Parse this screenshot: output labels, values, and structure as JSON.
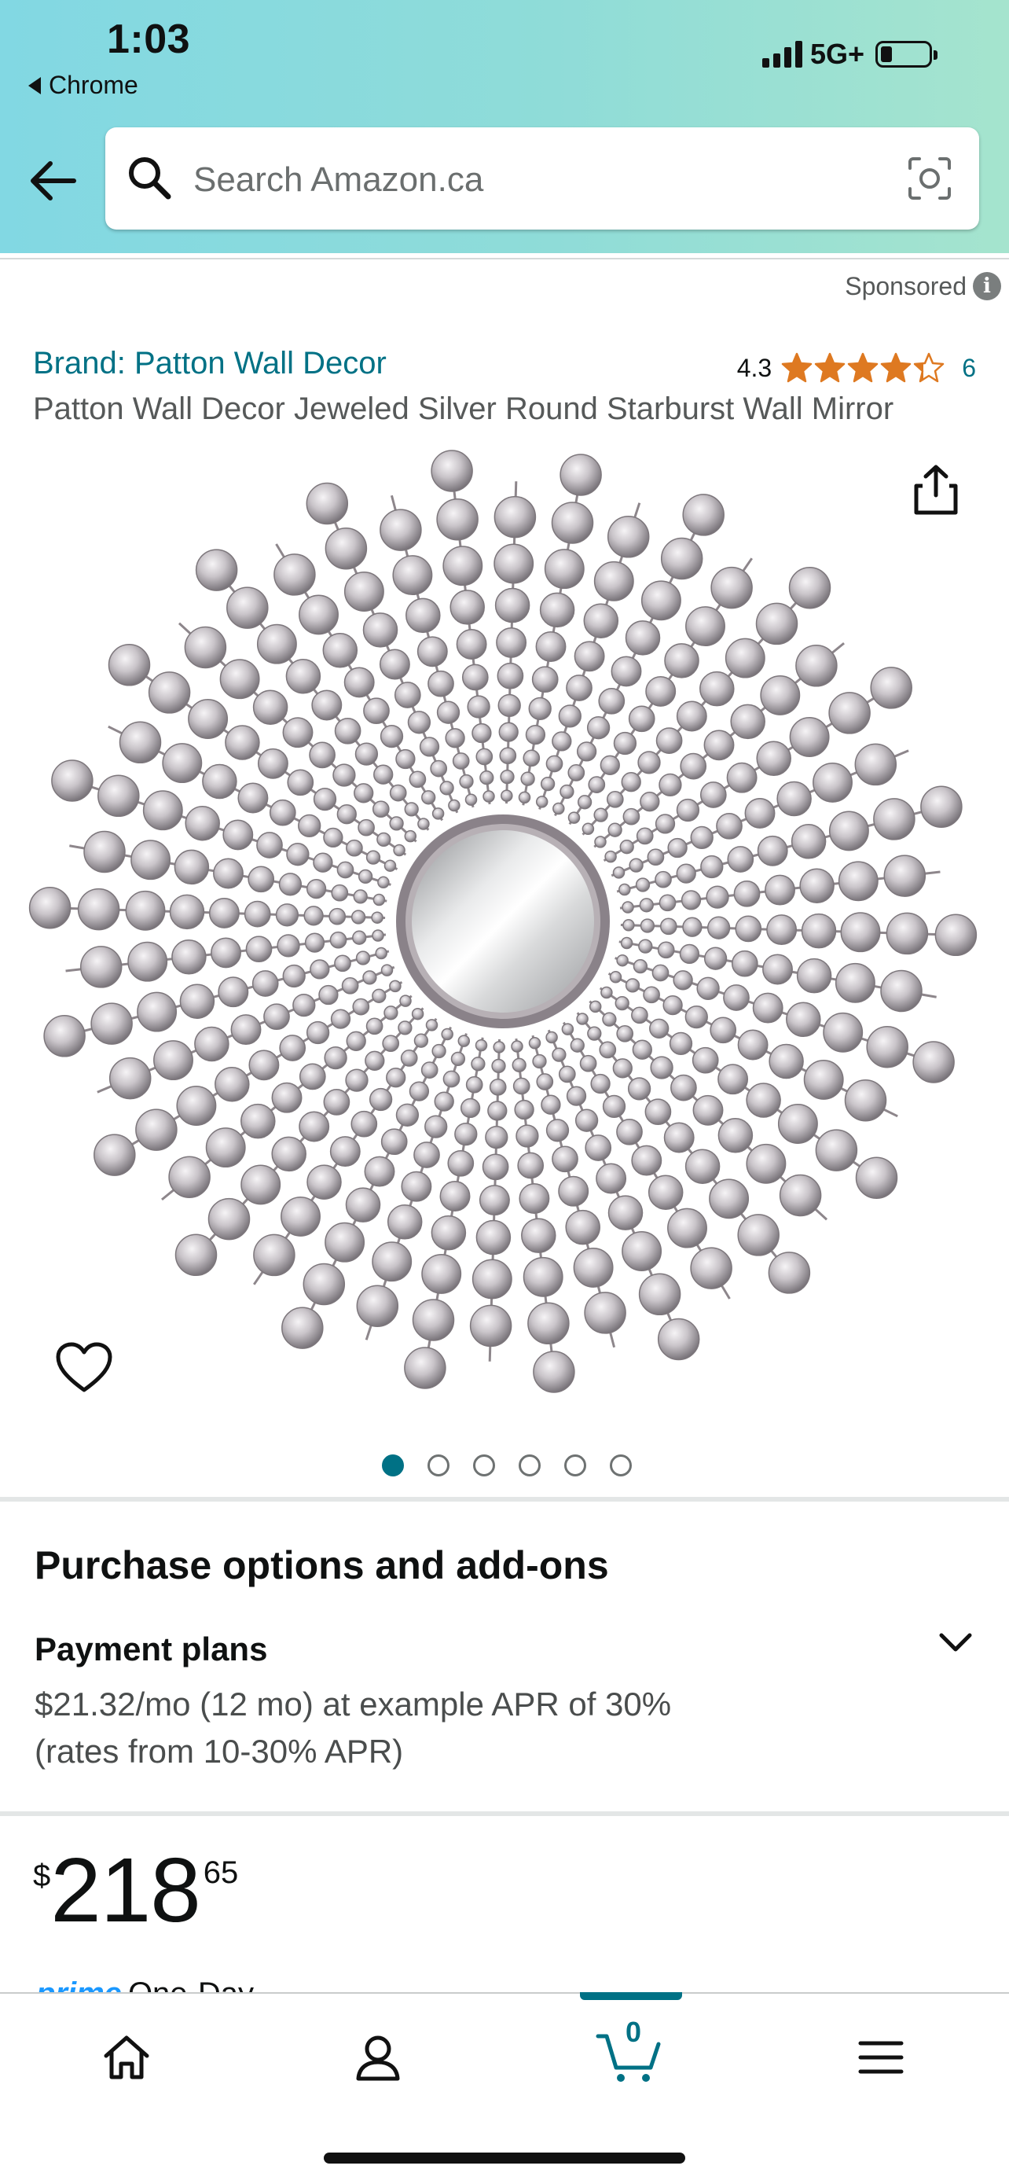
{
  "status_bar": {
    "time": "1:03",
    "back_app": "Chrome",
    "network": "5G+"
  },
  "search": {
    "placeholder": "Search Amazon.ca"
  },
  "ad": {
    "sponsored_label": "Sponsored",
    "info_glyph": "i"
  },
  "product": {
    "brand": "Brand: Patton Wall Decor",
    "rating_value": "4.3",
    "rating_stars": 4.3,
    "rating_count": "6",
    "title": "Patton Wall Decor Jeweled Silver Round Starburst Wall Mirror",
    "image_count": 6,
    "active_image_index": 0
  },
  "purchase": {
    "heading": "Purchase options and add-ons",
    "payment_title": "Payment plans",
    "payment_line1": "$21.32/mo (12 mo) at example APR of 30%",
    "payment_line2": "(rates from 10-30% APR)"
  },
  "price": {
    "symbol": "$",
    "whole": "218",
    "fraction": "65"
  },
  "delivery": {
    "prime": "prime",
    "text": "One-Day"
  },
  "bottom_nav": {
    "cart_count": "0",
    "tabs": [
      "home-icon",
      "account-icon",
      "cart-icon",
      "menu-icon"
    ]
  },
  "colors": {
    "link": "#007185",
    "star": "#de7921",
    "header_start": "#82d8e3",
    "header_end": "#a5e4ce"
  }
}
